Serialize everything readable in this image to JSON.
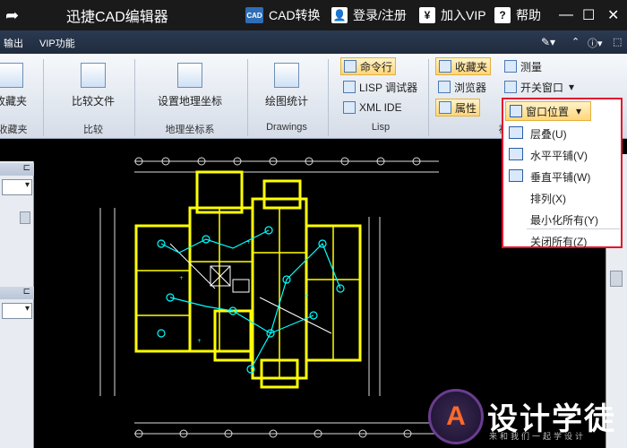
{
  "titlebar": {
    "app_title": "迅捷CAD编辑器",
    "cad_convert_icon": "CAD",
    "cad_convert": "CAD转换",
    "login": "登录/注册",
    "join_vip": "加入VIP",
    "help": "帮助",
    "help_icon": "?",
    "yen_icon": "¥"
  },
  "menubar": {
    "items": [
      "输出",
      "VIP功能"
    ]
  },
  "ribbon": {
    "favorites_btn": "收藏夹",
    "favorites_group": "收藏夹",
    "compare_btn": "比较文件",
    "compare_group": "比较",
    "geo_btn": "设置地理坐标",
    "geo_group": "地理坐标系",
    "stats_btn": "绘图统计",
    "drawings_group": "Drawings",
    "cmdline": "命令行",
    "lisp_debugger": "LISP 调试器",
    "xml_ide": "XML IDE",
    "lisp_group": "Lisp",
    "fav2": "收藏夹",
    "browser": "浏览器",
    "properties": "属性",
    "measure": "测量",
    "toggle_window": "开关窗口",
    "view_group_partial": "视"
  },
  "dropdown": {
    "title": "窗口位置",
    "items": [
      "层叠(U)",
      "水平平铺(V)",
      "垂直平铺(W)",
      "排列(X)",
      "最小化所有(Y)",
      "关闭所有(Z)"
    ]
  },
  "watermark": {
    "logo_letter": "A",
    "text": "设计学徒",
    "sub": "来和我们一起学设计"
  }
}
